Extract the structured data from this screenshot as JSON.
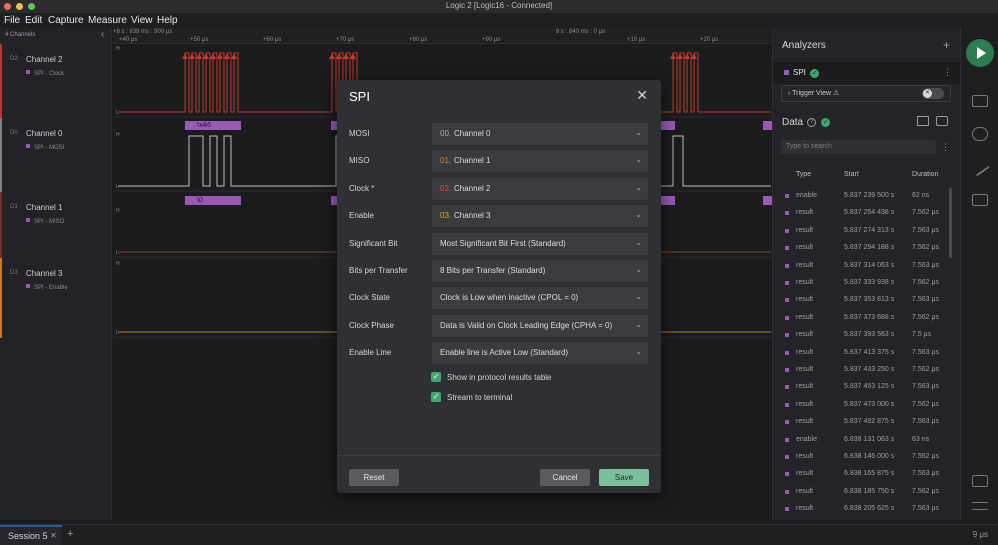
{
  "window": {
    "title": "Logic 2 [Logic16 - Connected]"
  },
  "menu": [
    "File",
    "Edit",
    "Capture",
    "Measure",
    "View",
    "Help"
  ],
  "channels": {
    "count_label": "4 Channels",
    "items": [
      {
        "num": "D2",
        "name": "Channel 2",
        "tag": "SPI - Clock",
        "color": "#c0392b"
      },
      {
        "num": "D0",
        "name": "Channel 0",
        "tag": "SPI - MOSI",
        "color": "#7f7f7f"
      },
      {
        "num": "D1",
        "name": "Channel 1",
        "tag": "SPI - MISO",
        "color": "#8e3b32"
      },
      {
        "num": "D3",
        "name": "Channel 3",
        "tag": "SPI - Enable",
        "color": "#c27c2a"
      }
    ]
  },
  "timeline": {
    "top_left": "+8 s : 839 ms : 900 μs",
    "top_mid": "8 s : 840 ms : 0 μs",
    "ticks": [
      "+40 μs",
      "+50 μs",
      "+60 μs",
      "+70 μs",
      "+80 μs",
      "+90 μs",
      "+10 μs",
      "+20 μs"
    ]
  },
  "decoded": {
    "mosi_first": "\\xA6",
    "miso_first": "\\0"
  },
  "dialog": {
    "title": "SPI",
    "fields": [
      {
        "label": "MOSI",
        "prefix": "00.",
        "prefix_color": "#b0b0b0",
        "value": "Channel 0"
      },
      {
        "label": "MISO",
        "prefix": "01.",
        "prefix_color": "#e07a3c",
        "value": "Channel 1"
      },
      {
        "label": "Clock *",
        "prefix": "02.",
        "prefix_color": "#e0563c",
        "value": "Channel 2"
      },
      {
        "label": "Enable",
        "prefix": "03.",
        "prefix_color": "#e0a43c",
        "value": "Channel 3"
      },
      {
        "label": "Significant Bit",
        "prefix": "",
        "value": "Most Significant Bit First (Standard)"
      },
      {
        "label": "Bits per Transfer",
        "prefix": "",
        "value": "8 Bits per Transfer (Standard)"
      },
      {
        "label": "Clock State",
        "prefix": "",
        "value": "Clock is Low when inactive (CPOL = 0)"
      },
      {
        "label": "Clock Phase",
        "prefix": "",
        "value": "Data is Valid on Clock Leading Edge (CPHA = 0)"
      },
      {
        "label": "Enable Line",
        "prefix": "",
        "value": "Enable line is Active Low (Standard)"
      }
    ],
    "checkboxes": [
      {
        "label": "Show in protocol results table",
        "checked": true
      },
      {
        "label": "Stream to terminal",
        "checked": true
      }
    ],
    "buttons": {
      "reset": "Reset",
      "cancel": "Cancel",
      "save": "Save"
    }
  },
  "analyzers": {
    "heading": "Analyzers",
    "analyzer_name": "SPI",
    "trigger_view": "Trigger View",
    "data_heading": "Data",
    "search_placeholder": "Type to search",
    "columns": [
      "Type",
      "Start",
      "Duration"
    ],
    "rows": [
      [
        "enable",
        "5.837 239 500 s",
        "62 ns"
      ],
      [
        "result",
        "5.837 254 438 s",
        "7.562 μs"
      ],
      [
        "result",
        "5.837 274 313 s",
        "7.563 μs"
      ],
      [
        "result",
        "5.837 294 188 s",
        "7.562 μs"
      ],
      [
        "result",
        "5.837 314 063 s",
        "7.563 μs"
      ],
      [
        "result",
        "5.837 333 938 s",
        "7.562 μs"
      ],
      [
        "result",
        "5.837 353 813 s",
        "7.563 μs"
      ],
      [
        "result",
        "5.837 373 688 s",
        "7.562 μs"
      ],
      [
        "result",
        "5.837 393 563 s",
        "7.5 μs"
      ],
      [
        "result",
        "5.837 413 375 s",
        "7.563 μs"
      ],
      [
        "result",
        "5.837 433 250 s",
        "7.562 μs"
      ],
      [
        "result",
        "5.837 453 125 s",
        "7.563 μs"
      ],
      [
        "result",
        "5.837 473 000 s",
        "7.562 μs"
      ],
      [
        "result",
        "5.837 492 875 s",
        "7.563 μs"
      ],
      [
        "enable",
        "6.838 131 063 s",
        "63 ns"
      ],
      [
        "result",
        "6.838 146 000 s",
        "7.562 μs"
      ],
      [
        "result",
        "6.838 165 875 s",
        "7.563 μs"
      ],
      [
        "result",
        "6.838 185 750 s",
        "7.562 μs"
      ],
      [
        "result",
        "6.838 205 625 s",
        "7.563 μs"
      ]
    ]
  },
  "bottom": {
    "session": "Session 5",
    "zoom": "9 μs"
  }
}
